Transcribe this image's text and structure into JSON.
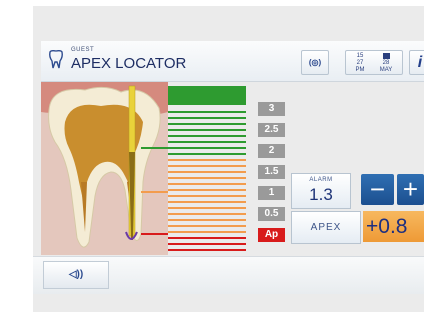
{
  "header": {
    "user": "GUEST",
    "title": "APEX LOCATOR",
    "signal_icon": "(◎)",
    "time": {
      "hour": "15",
      "minute": "27",
      "ampm": "PM"
    },
    "date": {
      "day": "28",
      "month": "MAY"
    },
    "info_icon": "i"
  },
  "scale": {
    "labels": [
      "3",
      "2.5",
      "2",
      "1.5",
      "1",
      "0.5",
      "Ap"
    ],
    "colors": {
      "green": "#2e9b30",
      "orange": "#f39c4d",
      "red": "#d81b1b",
      "tick": "#9a9a9a"
    }
  },
  "alarm": {
    "label": "ALARM",
    "value": "1.3",
    "minus": "−",
    "plus": "+"
  },
  "apex": {
    "label": "APEX",
    "value": "+0.8"
  },
  "footer": {
    "sound_icon": "◁))"
  }
}
